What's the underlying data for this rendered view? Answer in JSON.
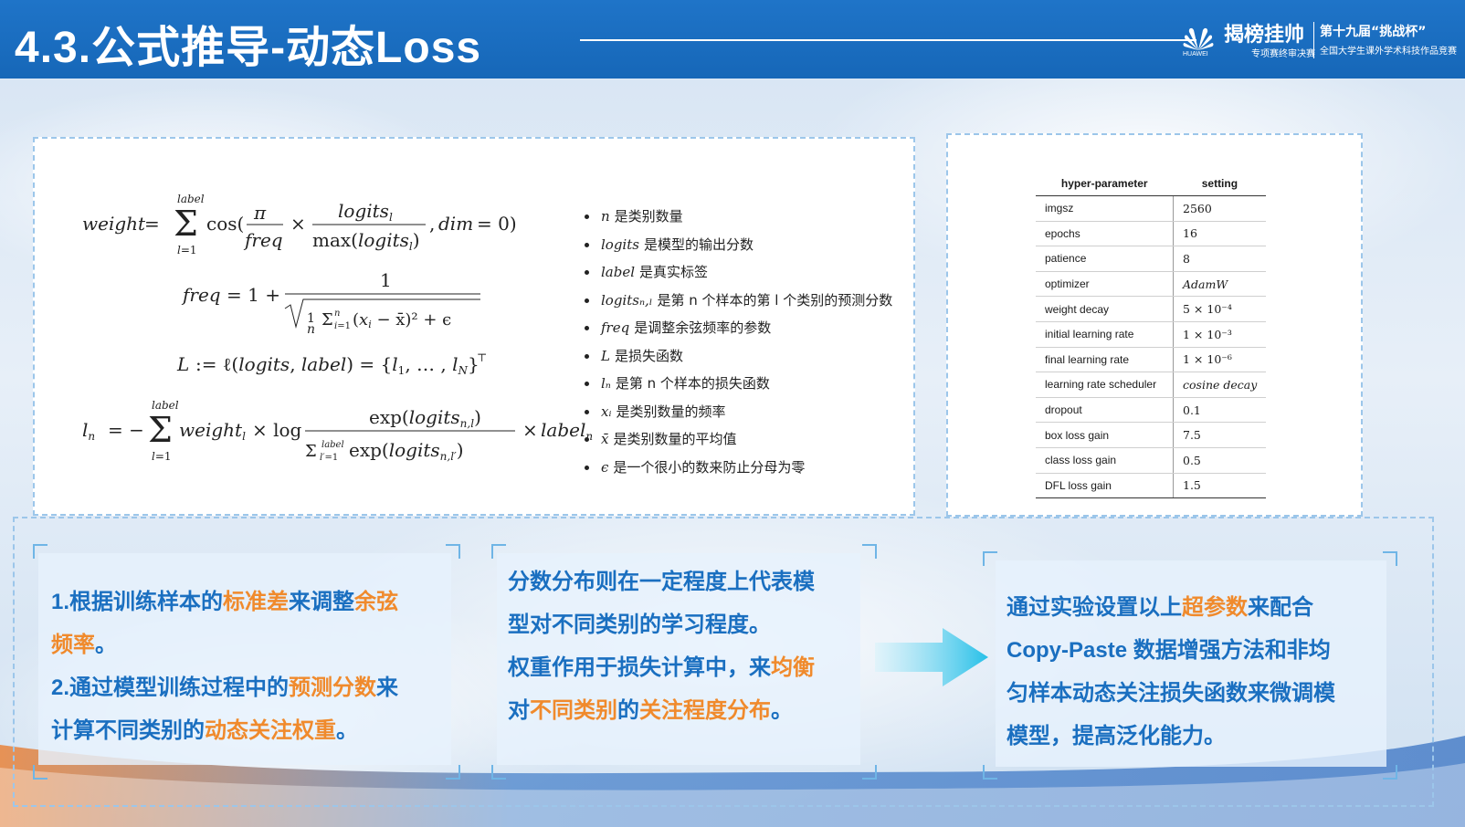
{
  "header": {
    "title": "4.3.公式推导-动态Loss",
    "logo_company": "HUAWEI",
    "brand_main": "揭榜挂帅",
    "brand_sub": "专项赛终审决赛",
    "competition_title": "第十九届“挑战杯”",
    "competition_sub": "全国大学生课外学术科技作品竞赛"
  },
  "definitions": [
    {
      "symbol": "n",
      "text": "是类别数量"
    },
    {
      "symbol": "logits",
      "text": "是模型的输出分数"
    },
    {
      "symbol": "label",
      "text": "是真实标签"
    },
    {
      "symbol": "logitsₙ,ₗ",
      "text": "是第 n 个样本的第 l 个类别的预测分数"
    },
    {
      "symbol": "freq",
      "text": "是调整余弦频率的参数"
    },
    {
      "symbol": "L",
      "text": "是损失函数"
    },
    {
      "symbol": "lₙ",
      "text": "是第 n 个样本的损失函数"
    },
    {
      "symbol": "xᵢ",
      "text": "是类别数量的频率"
    },
    {
      "symbol": "x̄",
      "text": "是类别数量的平均值"
    },
    {
      "symbol": "ϵ",
      "text": "是一个很小的数来防止分母为零"
    }
  ],
  "hyperparams": {
    "header": [
      "hyper-parameter",
      "setting"
    ],
    "rows": [
      {
        "key": "imgsz",
        "value": "2560"
      },
      {
        "key": "epochs",
        "value": "16"
      },
      {
        "key": "patience",
        "value": "8"
      },
      {
        "key": "optimizer",
        "value": "AdamW"
      },
      {
        "key": "weight decay",
        "value": "5 × 10⁻⁴"
      },
      {
        "key": "initial learning rate",
        "value": "1 × 10⁻³"
      },
      {
        "key": "final learning rate",
        "value": "1 × 10⁻⁶"
      },
      {
        "key": "learning rate scheduler",
        "value": "cosine decay"
      },
      {
        "key": "dropout",
        "value": "0.1"
      },
      {
        "key": "box loss gain",
        "value": "7.5"
      },
      {
        "key": "class loss gain",
        "value": "0.5"
      },
      {
        "key": "DFL loss gain",
        "value": "1.5"
      }
    ]
  },
  "callout1": {
    "l1a": "1.根据训练样本的",
    "l1b": "标准差",
    "l1c": "来调整",
    "l1d": "余弦",
    "l2a": "频率",
    "l2b": "。",
    "l3a": "2.通过模型训练过程中的",
    "l3b": "预测分数",
    "l3c": "来",
    "l4a": "计算不同类别的",
    "l4b": "动态关注权重",
    "l4c": "。"
  },
  "callout2": {
    "l1": "分数分布则在一定程度上代表模",
    "l2": "型对不同类别的学习程度。",
    "l3a": "权重作用于损失计算中，来",
    "l3b": "均衡",
    "l4a": "对",
    "l4b": "不同类别",
    "l4c": "的",
    "l4d": "关注程度分布",
    "l4e": "。"
  },
  "callout3": {
    "l1a": "通过实验设置以上",
    "l1b": "超参数",
    "l1c": "来配合",
    "l2": "Copy-Paste 数据增强方法和非均",
    "l3": "匀样本动态关注损失函数来微调模",
    "l4": "模型，提高泛化能力。"
  },
  "colors": {
    "header_blue": "#1a6cbf",
    "text_blue": "#1a6fc0",
    "highlight_orange": "#f08a2c",
    "dash_border": "#9cc6ea"
  }
}
